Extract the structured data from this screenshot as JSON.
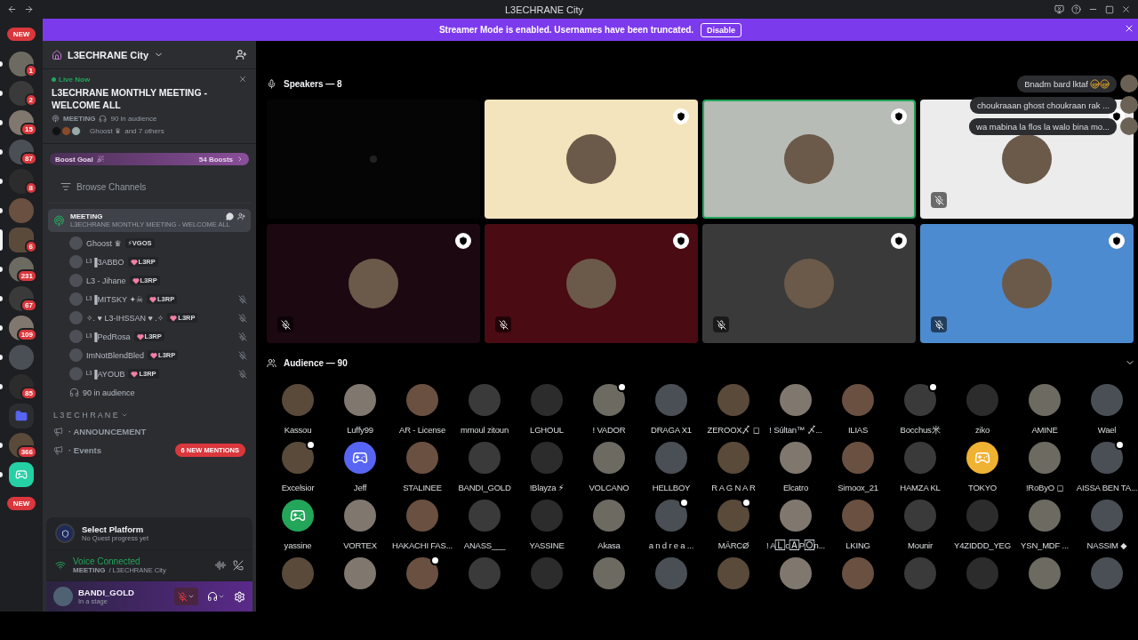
{
  "titlebar": {
    "title": "L3ECHRANE City"
  },
  "banner": {
    "text": "Streamer Mode is enabled. Usernames have been truncated.",
    "button": "Disable"
  },
  "server_rail": [
    {
      "kind": "new",
      "badge": "NEW"
    },
    {
      "kind": "photo",
      "badge": "1",
      "unread": true,
      "selected": false
    },
    {
      "kind": "photo",
      "badge": "2",
      "unread": true,
      "selected": false
    },
    {
      "kind": "photo",
      "badge": "15",
      "unread": true,
      "selected": false
    },
    {
      "kind": "photo",
      "badge": "87",
      "unread": true,
      "selected": false
    },
    {
      "kind": "photo",
      "badge": "8",
      "unread": true,
      "selected": false
    },
    {
      "kind": "photo",
      "unread": true,
      "selected": false
    },
    {
      "kind": "photo",
      "badge": "6",
      "unread": false,
      "selected": true
    },
    {
      "kind": "photo",
      "badge": "231",
      "unread": true,
      "selected": false
    },
    {
      "kind": "photo",
      "badge": "67",
      "unread": true,
      "selected": false
    },
    {
      "kind": "photo",
      "badge": "109",
      "unread": true,
      "selected": false
    },
    {
      "kind": "photo",
      "unread": true,
      "selected": false
    },
    {
      "kind": "photo",
      "badge": "85",
      "unread": true,
      "selected": false
    },
    {
      "kind": "folder"
    },
    {
      "kind": "photo",
      "badge": "366",
      "unread": true,
      "selected": false
    },
    {
      "kind": "logo",
      "color": "#25d0a4",
      "unread": true,
      "selected": false
    },
    {
      "kind": "new",
      "badge": "NEW"
    }
  ],
  "server_header": {
    "name": "L3ECHRANE City"
  },
  "live_event": {
    "status": "Live Now",
    "title": "L3ECHRANE MONTHLY MEETING - WELCOME ALL",
    "channel": "MEETING",
    "audience": "90 in audience",
    "host": "Ghoost ♛",
    "others": "and 7 others"
  },
  "boost_goal": {
    "label": "Boost Goal",
    "count": "54 Boosts"
  },
  "browse": "Browse Channels",
  "stage_channel": {
    "name": "MEETING",
    "topic": "L3ECHRANE MONTHLY MEETING - WELCOME ALL",
    "selected": true
  },
  "stage_users": [
    {
      "name": "Ghoost ♛",
      "tag": "⚡VGOS",
      "kind": "bolt",
      "muted": false
    },
    {
      "name": "ᴸ³▐3ABBO",
      "tag": "L3RP",
      "kind": "heart",
      "muted": false
    },
    {
      "name": "L3 - Jihane",
      "tag": "L3RP",
      "kind": "heart",
      "muted": false
    },
    {
      "name": "ᴸ³▐MITSKY ✦☠",
      "tag": "L3RP",
      "kind": "heart",
      "muted": true
    },
    {
      "name": "✧. ♥ L3-IHSSAN ♥ .✧",
      "tag": "L3RP",
      "kind": "heart",
      "muted": true
    },
    {
      "name": "ᴸ³▐PedRosa",
      "tag": "L3RP",
      "kind": "heart",
      "muted": true
    },
    {
      "name": "ImNotBlendBled",
      "tag": "L3RP",
      "kind": "heart",
      "muted": true
    },
    {
      "name": "ᴸ³▐AYOUB",
      "tag": "L3RP",
      "kind": "heart",
      "muted": true
    }
  ],
  "audience_count": "90 in audience",
  "category": "L 3 E C H R A N E",
  "channels": [
    {
      "name": "· ANNOUNCEMENT"
    },
    {
      "name": "· Events"
    }
  ],
  "mentions_pill": "6 NEW MENTIONS",
  "quest": {
    "title": "Select Platform",
    "subtitle": "No Quest progress yet"
  },
  "voice": {
    "status": "Voice Connected",
    "channel": "MEETING",
    "server": "/ L3ECHRANE City"
  },
  "user": {
    "name": "BANDI_GOLD",
    "status": "In a stage",
    "mic_muted": true
  },
  "speakers": {
    "title": "Speakers — 8",
    "tiles": [
      {
        "color": "#050505",
        "speaking": false,
        "muted": false,
        "shield": false
      },
      {
        "color": "#f3e4bd",
        "speaking": false,
        "muted": false,
        "shield": true
      },
      {
        "color": "#b8bcb7",
        "speaking": true,
        "muted": false,
        "shield": true
      },
      {
        "color": "#ececec",
        "speaking": false,
        "muted": true,
        "shield": true
      },
      {
        "color": "#1c0810",
        "speaking": false,
        "muted": true,
        "shield": true
      },
      {
        "color": "#4a0b12",
        "speaking": false,
        "muted": true,
        "shield": true
      },
      {
        "color": "#3a3a3a",
        "speaking": false,
        "muted": true,
        "shield": true
      },
      {
        "color": "#4d8bd0",
        "speaking": false,
        "muted": true,
        "shield": true
      }
    ]
  },
  "chat": [
    {
      "text": "Bnadm bard lktaf",
      "laughs": true
    },
    {
      "text": "choukraaan ghost choukraan rak ...",
      "laughs": false
    },
    {
      "text": "wa mabina la flos la walo bina mo...",
      "laughs": false
    }
  ],
  "audience": {
    "title": "Audience — 90",
    "members": [
      {
        "name": "Kassou",
        "kind": "photo",
        "badge": false
      },
      {
        "name": "Luffy99",
        "kind": "photo",
        "badge": false
      },
      {
        "name": "AR - License",
        "kind": "photo",
        "badge": false
      },
      {
        "name": "mmoul zitoun",
        "kind": "photo",
        "badge": false
      },
      {
        "name": "LGHOUL",
        "kind": "photo",
        "badge": false
      },
      {
        "name": "! VADOR",
        "kind": "photo",
        "badge": true
      },
      {
        "name": "DRAGA X1",
        "kind": "photo",
        "badge": false
      },
      {
        "name": "ZEROOX〆 ◻",
        "kind": "photo",
        "badge": false
      },
      {
        "name": "! Súltan™ 〆...",
        "kind": "photo",
        "badge": false
      },
      {
        "name": "ILIAS",
        "kind": "photo",
        "badge": false
      },
      {
        "name": "Bocchus米",
        "kind": "photo",
        "badge": true
      },
      {
        "name": "ziko",
        "kind": "photo",
        "badge": false
      },
      {
        "name": "AMINE",
        "kind": "photo",
        "badge": false
      },
      {
        "name": "Wael",
        "kind": "photo",
        "badge": false
      },
      {
        "name": "Excelsior",
        "kind": "photo",
        "badge": true
      },
      {
        "name": "Jeff",
        "kind": "default",
        "color": "#5865f2",
        "badge": false
      },
      {
        "name": "STALINEE",
        "kind": "photo",
        "badge": false
      },
      {
        "name": "BANDI_GOLD",
        "kind": "photo",
        "badge": false
      },
      {
        "name": "!Blayza ⚡",
        "kind": "photo",
        "badge": false
      },
      {
        "name": "VOLCANO",
        "kind": "photo",
        "badge": false
      },
      {
        "name": "HELLBOY",
        "kind": "photo",
        "badge": false
      },
      {
        "name": "R A G N A R",
        "kind": "photo",
        "badge": false
      },
      {
        "name": "Elcatro",
        "kind": "photo",
        "badge": false
      },
      {
        "name": "Simoox_21",
        "kind": "photo",
        "badge": false
      },
      {
        "name": "HAMZA KL",
        "kind": "photo",
        "badge": false
      },
      {
        "name": "TOKYO",
        "kind": "default",
        "color": "#f0b232",
        "badge": false
      },
      {
        "name": "!RoByO ◻",
        "kind": "photo",
        "badge": false
      },
      {
        "name": "AISSA BEN TA...",
        "kind": "photo",
        "badge": true
      },
      {
        "name": "yassine",
        "kind": "default",
        "color": "#23a55a",
        "badge": false
      },
      {
        "name": "VORTEX",
        "kind": "photo",
        "badge": false
      },
      {
        "name": "HAKACHI FAS...",
        "kind": "photo",
        "badge": false
      },
      {
        "name": "ANASS___",
        "kind": "photo",
        "badge": false
      },
      {
        "name": "YASSINE",
        "kind": "photo",
        "badge": false
      },
      {
        "name": "Akasa",
        "kind": "photo",
        "badge": false
      },
      {
        "name": "a n d r e a ...",
        "kind": "photo",
        "badge": true
      },
      {
        "name": "MĀRCØ",
        "kind": "photo",
        "badge": true
      },
      {
        "name": "! A🄻c🄰P🄾n...",
        "kind": "photo",
        "badge": false
      },
      {
        "name": "LKING",
        "kind": "photo",
        "badge": false
      },
      {
        "name": "Mounir",
        "kind": "photo",
        "badge": false
      },
      {
        "name": "Y4ZIDDD_YEG",
        "kind": "photo",
        "badge": false
      },
      {
        "name": "YSN_MDF ...",
        "kind": "photo",
        "badge": false
      },
      {
        "name": "NASSIM ◆",
        "kind": "photo",
        "badge": false
      },
      {
        "kind": "photo",
        "badge": false
      },
      {
        "kind": "photo",
        "badge": false
      },
      {
        "kind": "photo",
        "badge": true
      },
      {
        "kind": "photo",
        "badge": false
      },
      {
        "kind": "photo",
        "badge": false
      },
      {
        "kind": "photo",
        "badge": false
      },
      {
        "kind": "photo",
        "badge": false
      },
      {
        "kind": "photo",
        "badge": false
      },
      {
        "kind": "photo",
        "badge": false
      },
      {
        "kind": "photo",
        "badge": false
      },
      {
        "kind": "photo",
        "badge": false
      },
      {
        "kind": "photo",
        "badge": false
      },
      {
        "kind": "photo",
        "badge": false
      },
      {
        "kind": "photo",
        "badge": false
      }
    ]
  }
}
